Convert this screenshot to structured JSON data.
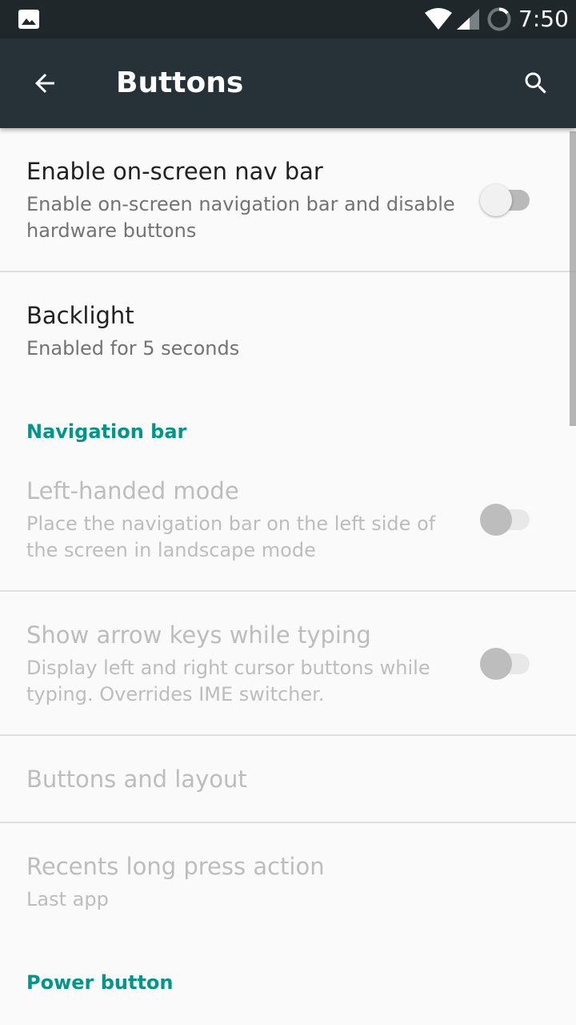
{
  "status_bar": {
    "time": "7:50",
    "icons": [
      "image-icon",
      "wifi-icon",
      "cellular-signal-icon",
      "battery-icon"
    ]
  },
  "app_bar": {
    "title": "Buttons",
    "back_icon": "arrow-left-icon",
    "search_icon": "search-icon",
    "background": "#263238"
  },
  "colors": {
    "accent": "#009688",
    "status_bar": "#1f272b",
    "background": "#fafafa",
    "disabled_text": "#bdbdbd"
  },
  "prefs": {
    "nav_bar": {
      "title": "Enable on-screen nav bar",
      "summary": "Enable on-screen navigation bar and disable hardware buttons",
      "switch_on": false,
      "enabled": true
    },
    "backlight": {
      "title": "Backlight",
      "summary": "Enabled for 5 seconds",
      "enabled": true
    },
    "navigation_header": "Navigation bar",
    "left_handed": {
      "title": "Left-handed mode",
      "summary": "Place the navigation bar on the left side of the screen in landscape mode",
      "switch_on": false,
      "enabled": false
    },
    "arrow_keys": {
      "title": "Show arrow keys while typing",
      "summary": "Display left and right cursor buttons while typing. Overrides IME switcher.",
      "switch_on": false,
      "enabled": false
    },
    "buttons_layout": {
      "title": "Buttons and layout",
      "enabled": false
    },
    "recents": {
      "title": "Recents long press action",
      "summary": "Last app",
      "enabled": false
    },
    "power_header": "Power button"
  }
}
